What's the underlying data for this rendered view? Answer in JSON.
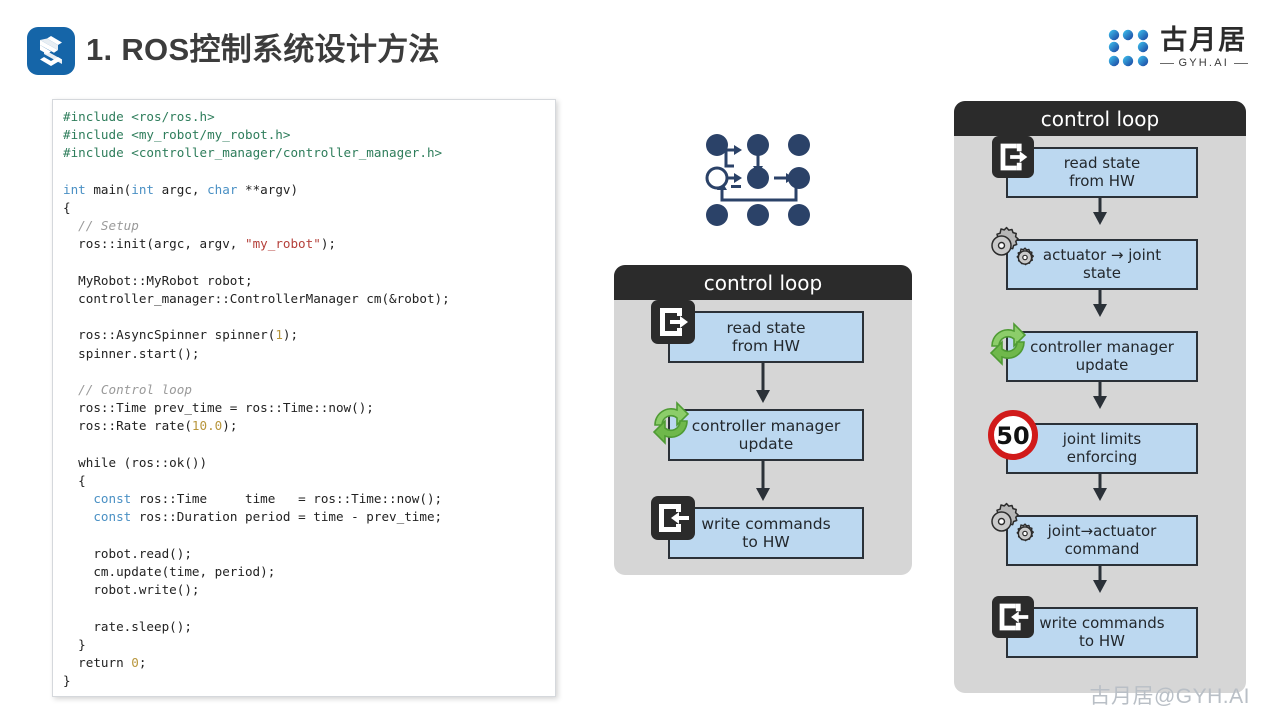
{
  "header": {
    "title": "1. ROS控制系统设计方法",
    "brand_icon": "stacked-s-logo-icon",
    "logo": {
      "cn": "古月居",
      "en": "GYH.AI",
      "mark_icon": "gyh-node-network-icon"
    },
    "accent_color": "#1565a8"
  },
  "code_panel": {
    "language": "cpp",
    "lines": [
      [
        {
          "t": "#include ",
          "c": "pre"
        },
        {
          "t": "<ros/ros.h>",
          "c": "pre"
        }
      ],
      [
        {
          "t": "#include ",
          "c": "pre"
        },
        {
          "t": "<my_robot/my_robot.h>",
          "c": "pre"
        }
      ],
      [
        {
          "t": "#include ",
          "c": "pre"
        },
        {
          "t": "<controller_manager/controller_manager.h>",
          "c": "pre"
        }
      ],
      [
        {
          "t": "",
          "c": "pl"
        }
      ],
      [
        {
          "t": "int",
          "c": "kw"
        },
        {
          "t": " main(",
          "c": "pl"
        },
        {
          "t": "int",
          "c": "kw"
        },
        {
          "t": " argc, ",
          "c": "pl"
        },
        {
          "t": "char",
          "c": "kw"
        },
        {
          "t": " **argv)",
          "c": "pl"
        }
      ],
      [
        {
          "t": "{",
          "c": "pl"
        }
      ],
      [
        {
          "t": "  // Setup",
          "c": "cmt"
        }
      ],
      [
        {
          "t": "  ros::init(argc, argv, ",
          "c": "pl"
        },
        {
          "t": "\"my_robot\"",
          "c": "str"
        },
        {
          "t": ");",
          "c": "pl"
        }
      ],
      [
        {
          "t": "",
          "c": "pl"
        }
      ],
      [
        {
          "t": "  MyRobot::MyRobot robot;",
          "c": "pl"
        }
      ],
      [
        {
          "t": "  controller_manager::ControllerManager cm(&robot);",
          "c": "pl"
        }
      ],
      [
        {
          "t": "",
          "c": "pl"
        }
      ],
      [
        {
          "t": "  ros::AsyncSpinner spinner(",
          "c": "pl"
        },
        {
          "t": "1",
          "c": "num"
        },
        {
          "t": ");",
          "c": "pl"
        }
      ],
      [
        {
          "t": "  spinner.start();",
          "c": "pl"
        }
      ],
      [
        {
          "t": "",
          "c": "pl"
        }
      ],
      [
        {
          "t": "  // Control loop",
          "c": "cmt"
        }
      ],
      [
        {
          "t": "  ros::Time prev_time = ros::Time::now();",
          "c": "pl"
        }
      ],
      [
        {
          "t": "  ros::Rate rate(",
          "c": "pl"
        },
        {
          "t": "10.0",
          "c": "num"
        },
        {
          "t": ");",
          "c": "pl"
        }
      ],
      [
        {
          "t": "",
          "c": "pl"
        }
      ],
      [
        {
          "t": "  while (ros::ok())",
          "c": "pl"
        }
      ],
      [
        {
          "t": "  {",
          "c": "pl"
        }
      ],
      [
        {
          "t": "    ",
          "c": "pl"
        },
        {
          "t": "const",
          "c": "kw"
        },
        {
          "t": " ros::Time     time   = ros::Time::now();",
          "c": "pl"
        }
      ],
      [
        {
          "t": "    ",
          "c": "pl"
        },
        {
          "t": "const",
          "c": "kw"
        },
        {
          "t": " ros::Duration period = time - prev_time;",
          "c": "pl"
        }
      ],
      [
        {
          "t": "",
          "c": "pl"
        }
      ],
      [
        {
          "t": "    robot.read();",
          "c": "pl"
        }
      ],
      [
        {
          "t": "    cm.update(time, period);",
          "c": "pl"
        }
      ],
      [
        {
          "t": "    robot.write();",
          "c": "pl"
        }
      ],
      [
        {
          "t": "",
          "c": "pl"
        }
      ],
      [
        {
          "t": "    rate.sleep();",
          "c": "pl"
        }
      ],
      [
        {
          "t": "  }",
          "c": "pl"
        }
      ],
      [
        {
          "t": "  return ",
          "c": "pl"
        },
        {
          "t": "0",
          "c": "num"
        },
        {
          "t": ";",
          "c": "pl"
        }
      ],
      [
        {
          "t": "}",
          "c": "pl"
        }
      ]
    ]
  },
  "node_graph": {
    "name": "ros-node-graph-icon",
    "node_color": "#2b4268"
  },
  "diagrams": [
    {
      "id": "control-loop-simple",
      "title": "control loop",
      "steps": [
        {
          "label_lines": [
            "read state",
            "from HW"
          ],
          "icon": "door-in-icon"
        },
        {
          "label_lines": [
            "controller manager",
            "update"
          ],
          "icon": "refresh-cycle-icon"
        },
        {
          "label_lines": [
            "write commands",
            "to HW"
          ],
          "icon": "door-out-icon"
        }
      ]
    },
    {
      "id": "control-loop-full",
      "title": "control loop",
      "steps": [
        {
          "label_lines": [
            "read state",
            "from HW"
          ],
          "icon": "door-in-icon"
        },
        {
          "label_lines": [
            "actuator → joint",
            "state"
          ],
          "icon": "gears-icon"
        },
        {
          "label_lines": [
            "controller manager",
            "update"
          ],
          "icon": "refresh-cycle-icon"
        },
        {
          "label_lines": [
            "joint limits",
            "enforcing"
          ],
          "icon": "speed-limit-50-icon"
        },
        {
          "label_lines": [
            "joint→actuator",
            "command"
          ],
          "icon": "gears-icon"
        },
        {
          "label_lines": [
            "write commands",
            "to HW"
          ],
          "icon": "door-out-icon"
        }
      ]
    }
  ],
  "watermark": "古月居@GYH.AI",
  "colors": {
    "box_fill": "#bcd8f0",
    "box_stroke": "#2b3138",
    "panel_fill": "#d6d6d6",
    "panel_header": "#2b2b2b",
    "limit_red": "#d11a1a",
    "gear_gray": "#b4b4b4",
    "recycle_green": "#7ec25a"
  }
}
